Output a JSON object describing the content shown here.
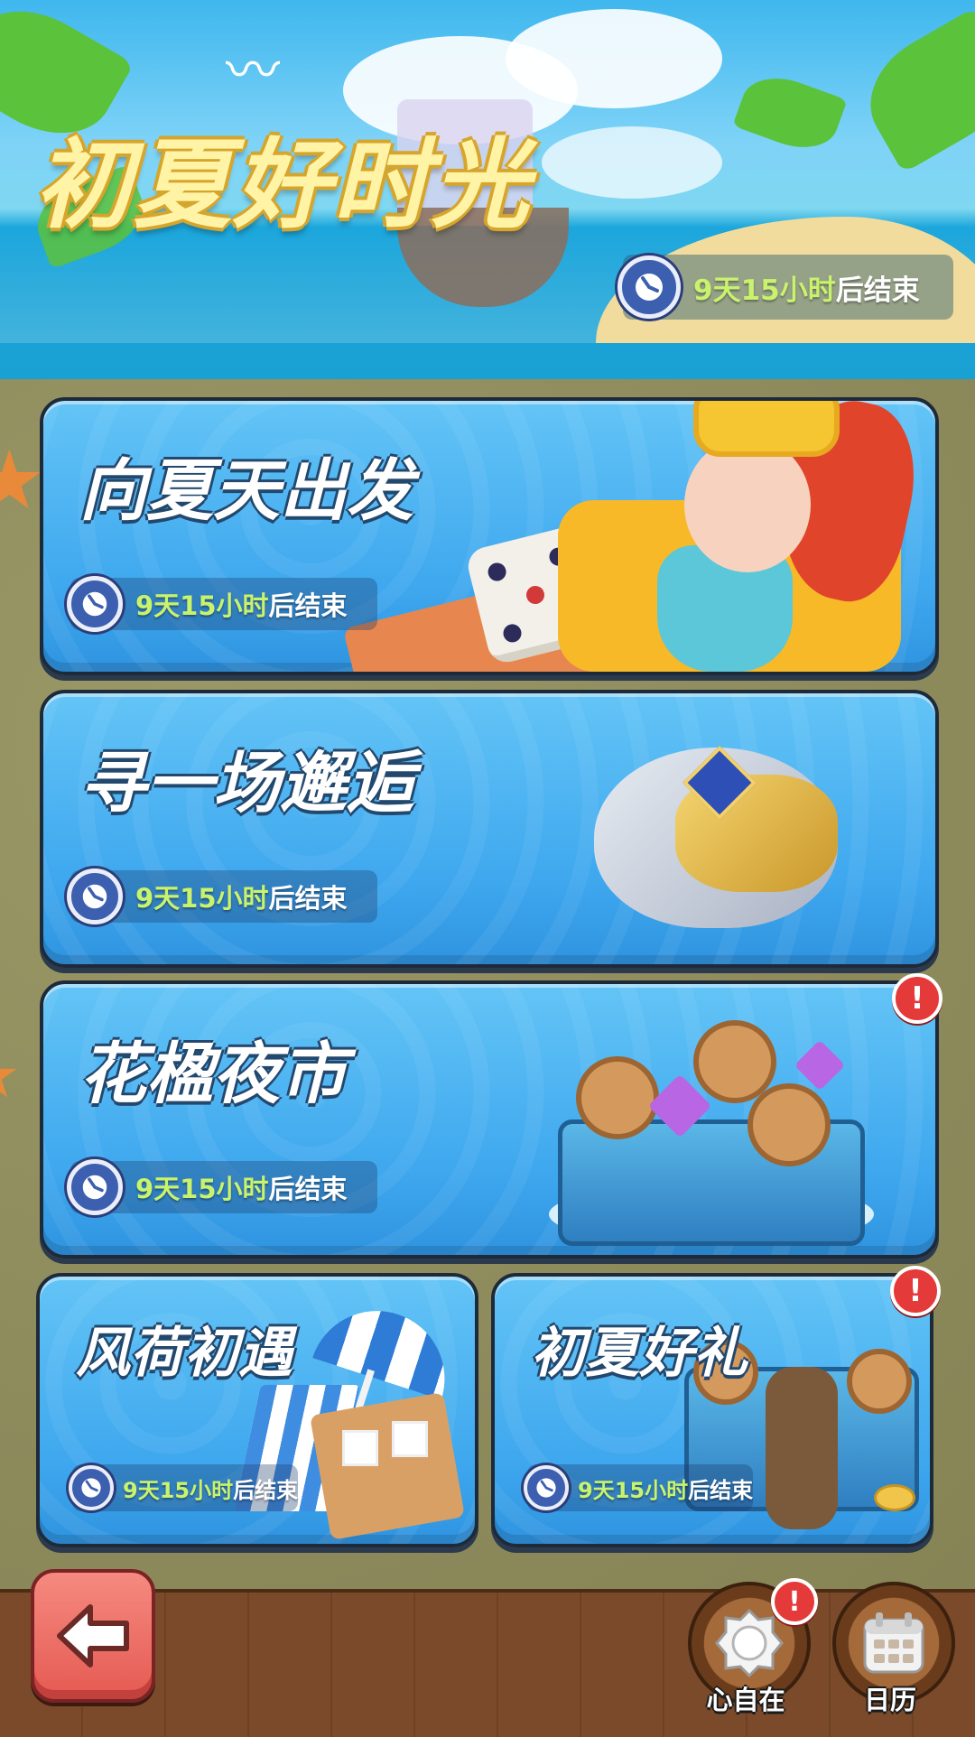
{
  "banner": {
    "title": "初夏好时光",
    "timer": {
      "highlight": "9天15小时",
      "suffix": "后结束"
    }
  },
  "events": [
    {
      "title": "向夏天出发",
      "timer": {
        "highlight": "9天15小时",
        "suffix": "后结束"
      },
      "badge": null
    },
    {
      "title": "寻一场邂逅",
      "timer": {
        "highlight": "9天15小时",
        "suffix": "后结束"
      },
      "badge": null
    },
    {
      "title": "花楹夜市",
      "timer": {
        "highlight": "9天15小时",
        "suffix": "后结束"
      },
      "badge": "!"
    },
    {
      "title": "风荷初遇",
      "timer": {
        "highlight": "9天15小时",
        "suffix": "后结束"
      },
      "badge": null
    },
    {
      "title": "初夏好礼",
      "timer": {
        "highlight": "9天15小时",
        "suffix": "后结束"
      },
      "badge": "!"
    }
  ],
  "bottom": {
    "heart_label": "心自在",
    "heart_badge": "!",
    "calendar_label": "日历"
  },
  "icons": {
    "timer": "clock-icon",
    "back": "arrow-left-icon",
    "heart": "gear-badge-icon",
    "calendar": "calendar-icon"
  },
  "colors": {
    "timer_highlight": "#c9f26d",
    "card_blue": "#3ea7ee",
    "badge_red": "#e53a3a",
    "back_button": "#e55a52",
    "title_yellow": "#fff3a5"
  }
}
